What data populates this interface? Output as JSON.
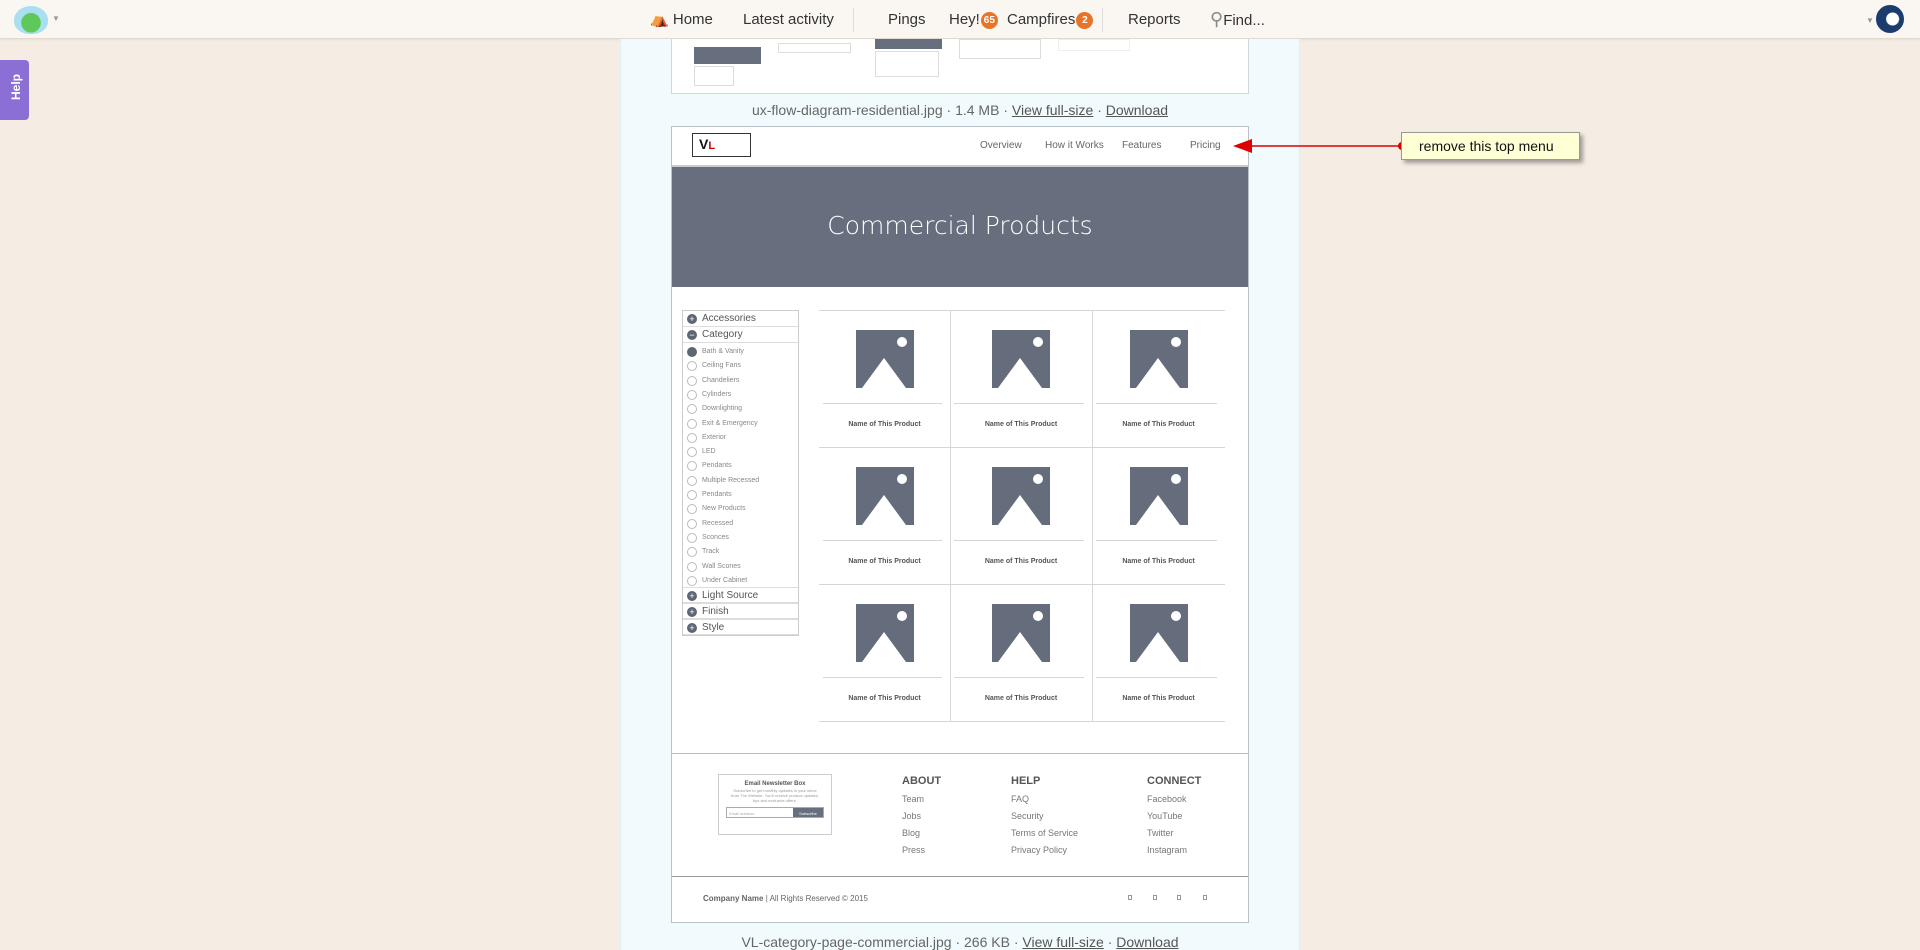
{
  "topbar": {
    "nav": [
      {
        "label": "Home"
      },
      {
        "label": "Latest activity"
      },
      {
        "label": "Pings"
      },
      {
        "label": "Hey!",
        "badge": "65"
      },
      {
        "label": "Campfires",
        "badge": "2"
      },
      {
        "label": "Reports"
      },
      {
        "label": "Find..."
      }
    ],
    "badge_color": "#e8742a"
  },
  "help": {
    "label": "Help"
  },
  "attachments": [
    {
      "filename": "ux-flow-diagram-residential.jpg",
      "size": "1.4 MB",
      "view": "View full-size",
      "download": "Download"
    },
    {
      "filename": "VL-category-page-commercial.jpg",
      "size": "266 KB",
      "view": "View full-size",
      "download": "Download"
    }
  ],
  "sep": "·",
  "mockup": {
    "nav": [
      "Overview",
      "How it Works",
      "Features",
      "Pricing"
    ],
    "hero_title": "Commercial Products",
    "filters": {
      "top": [
        "Accessories",
        "Category"
      ],
      "category_items": [
        "Bath & Vanity",
        "Ceiling Fans",
        "Chandeliers",
        "Cylinders",
        "Downlighting",
        "Exit & Emergency",
        "Exterior",
        "LED",
        "Pendants",
        "Multiple Recessed",
        "Pendants",
        "New Products",
        "Recessed",
        "Sconces",
        "Track",
        "Wall Scones",
        "Under Cabinet"
      ],
      "selected": 0,
      "bottom": [
        "Light Source",
        "Finish",
        "Style"
      ]
    },
    "products": [
      "Name of This Product",
      "Name of This Product",
      "Name of This Product",
      "Name of This Product",
      "Name of This Product",
      "Name of This Product",
      "Name of This Product",
      "Name of This Product",
      "Name of This Product"
    ],
    "newsletter": {
      "title": "Email Newsletter Box",
      "text": "Subscribe to get monthly updates in your inbox from The Website. You'll receive product updates, tips and exclusive offers.",
      "placeholder": "Email address",
      "button": "Subscribe"
    },
    "footer_cols": [
      {
        "title": "ABOUT",
        "links": [
          "Team",
          "Jobs",
          "Blog",
          "Press"
        ]
      },
      {
        "title": "HELP",
        "links": [
          "FAQ",
          "Security",
          "Terms of Service",
          "Privacy Policy"
        ]
      },
      {
        "title": "CONNECT",
        "links": [
          "Facebook",
          "YouTube",
          "Twitter",
          "Instagram"
        ]
      }
    ],
    "company": "Company Name",
    "rights": "| All Rights Reserved  © 2015"
  },
  "annotation": {
    "text": "remove this top menu",
    "color": "#dd0000"
  }
}
